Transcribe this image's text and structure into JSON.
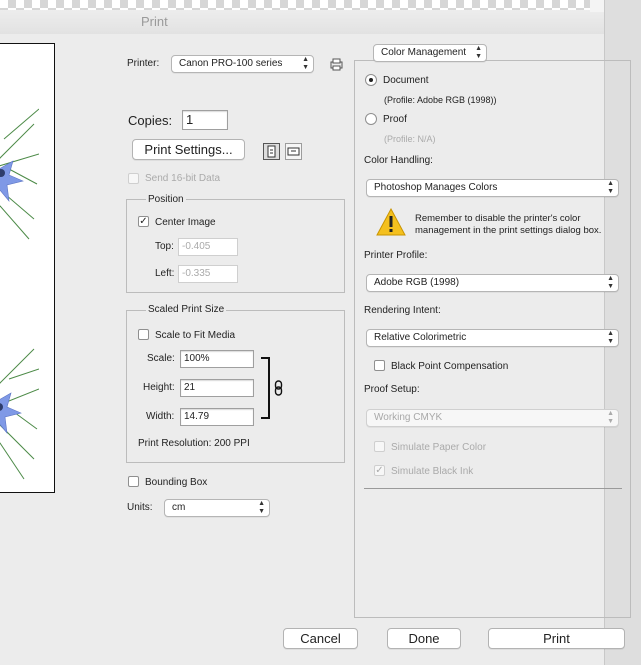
{
  "window": {
    "title": "Print"
  },
  "printer": {
    "label": "Printer:",
    "value": "Canon PRO-100 series"
  },
  "copies": {
    "label": "Copies:",
    "value": "1"
  },
  "print_settings": {
    "label": "Print Settings..."
  },
  "send16bit": {
    "label": "Send 16-bit Data",
    "checked": false,
    "enabled": false
  },
  "position": {
    "title": "Position",
    "center_image": {
      "label": "Center Image",
      "checked": true
    },
    "top": {
      "label": "Top:",
      "value": "-0.405"
    },
    "left": {
      "label": "Left:",
      "value": "-0.335"
    }
  },
  "scaled": {
    "title": "Scaled Print Size",
    "scale_to_fit": {
      "label": "Scale to Fit Media",
      "checked": false
    },
    "scale": {
      "label": "Scale:",
      "value": "100%"
    },
    "height": {
      "label": "Height:",
      "value": "21"
    },
    "width": {
      "label": "Width:",
      "value": "14.79"
    },
    "resolution": "Print Resolution: 200 PPI"
  },
  "bounding_box": {
    "label": "Bounding Box",
    "checked": false
  },
  "units": {
    "label": "Units:",
    "value": "cm"
  },
  "color_management": {
    "section_popup": "Color Management",
    "document": {
      "label": "Document",
      "profile": "(Profile: Adobe RGB (1998))",
      "selected": true
    },
    "proof": {
      "label": "Proof",
      "profile": "(Profile: N/A)",
      "selected": false
    },
    "color_handling": {
      "label": "Color Handling:",
      "value": "Photoshop Manages Colors"
    },
    "warning": "Remember to disable the printer's color management in the print settings dialog box.",
    "printer_profile": {
      "label": "Printer Profile:",
      "value": "Adobe RGB (1998)"
    },
    "rendering_intent": {
      "label": "Rendering Intent:",
      "value": "Relative Colorimetric"
    },
    "black_point": {
      "label": "Black Point Compensation",
      "checked": false
    },
    "proof_setup": {
      "label": "Proof Setup:",
      "value": "Working CMYK"
    },
    "simulate_paper": {
      "label": "Simulate Paper Color",
      "checked": false,
      "enabled": false
    },
    "simulate_black": {
      "label": "Simulate Black Ink",
      "checked": true,
      "enabled": false
    }
  },
  "buttons": {
    "cancel": "Cancel",
    "done": "Done",
    "print": "Print"
  },
  "icons": {
    "printer_setup": "printer-setup-icon",
    "portrait": "portrait-orientation-icon",
    "landscape": "landscape-orientation-icon",
    "warning": "warning-triangle-icon",
    "link": "chain-link-icon"
  },
  "colors": {
    "accent_warning": "#f4c01e",
    "flower": "#7f99e6"
  }
}
